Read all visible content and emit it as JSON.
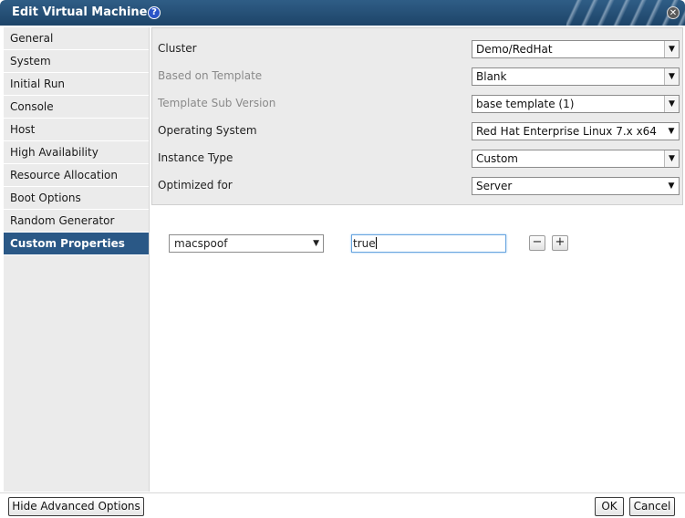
{
  "window": {
    "title": "Edit Virtual Machine",
    "help_glyph": "?",
    "close_glyph": "✕"
  },
  "sidebar": {
    "items": [
      {
        "label": "General"
      },
      {
        "label": "System"
      },
      {
        "label": "Initial Run"
      },
      {
        "label": "Console"
      },
      {
        "label": "Host"
      },
      {
        "label": "High Availability"
      },
      {
        "label": "Resource Allocation"
      },
      {
        "label": "Boot Options"
      },
      {
        "label": "Random Generator"
      },
      {
        "label": "Custom Properties",
        "active": true
      }
    ]
  },
  "general_fields": [
    {
      "label": "Cluster",
      "value": "Demo/RedHat",
      "disabled": false
    },
    {
      "label": "Based on Template",
      "value": "Blank",
      "disabled": true
    },
    {
      "label": "Template Sub Version",
      "value": "base template (1)",
      "disabled": true
    },
    {
      "label": "Operating System",
      "value": "Red Hat Enterprise Linux 7.x x64",
      "disabled": false
    },
    {
      "label": "Instance Type",
      "value": "Custom",
      "disabled": false
    },
    {
      "label": "Optimized for",
      "value": "Server",
      "disabled": false
    }
  ],
  "custom_properties": {
    "key": "macspoof",
    "value": "true",
    "remove_glyph": "−",
    "add_glyph": "+"
  },
  "footer": {
    "advanced_label": "Hide Advanced Options",
    "ok_label": "OK",
    "cancel_label": "Cancel"
  },
  "colors": {
    "title_bar": "#1d4468",
    "active_tab": "#2a5886",
    "focus": "#6aa6e0"
  },
  "icons": {
    "help": "help-icon",
    "close": "close-icon",
    "dropdown": "chevron-down-icon"
  }
}
